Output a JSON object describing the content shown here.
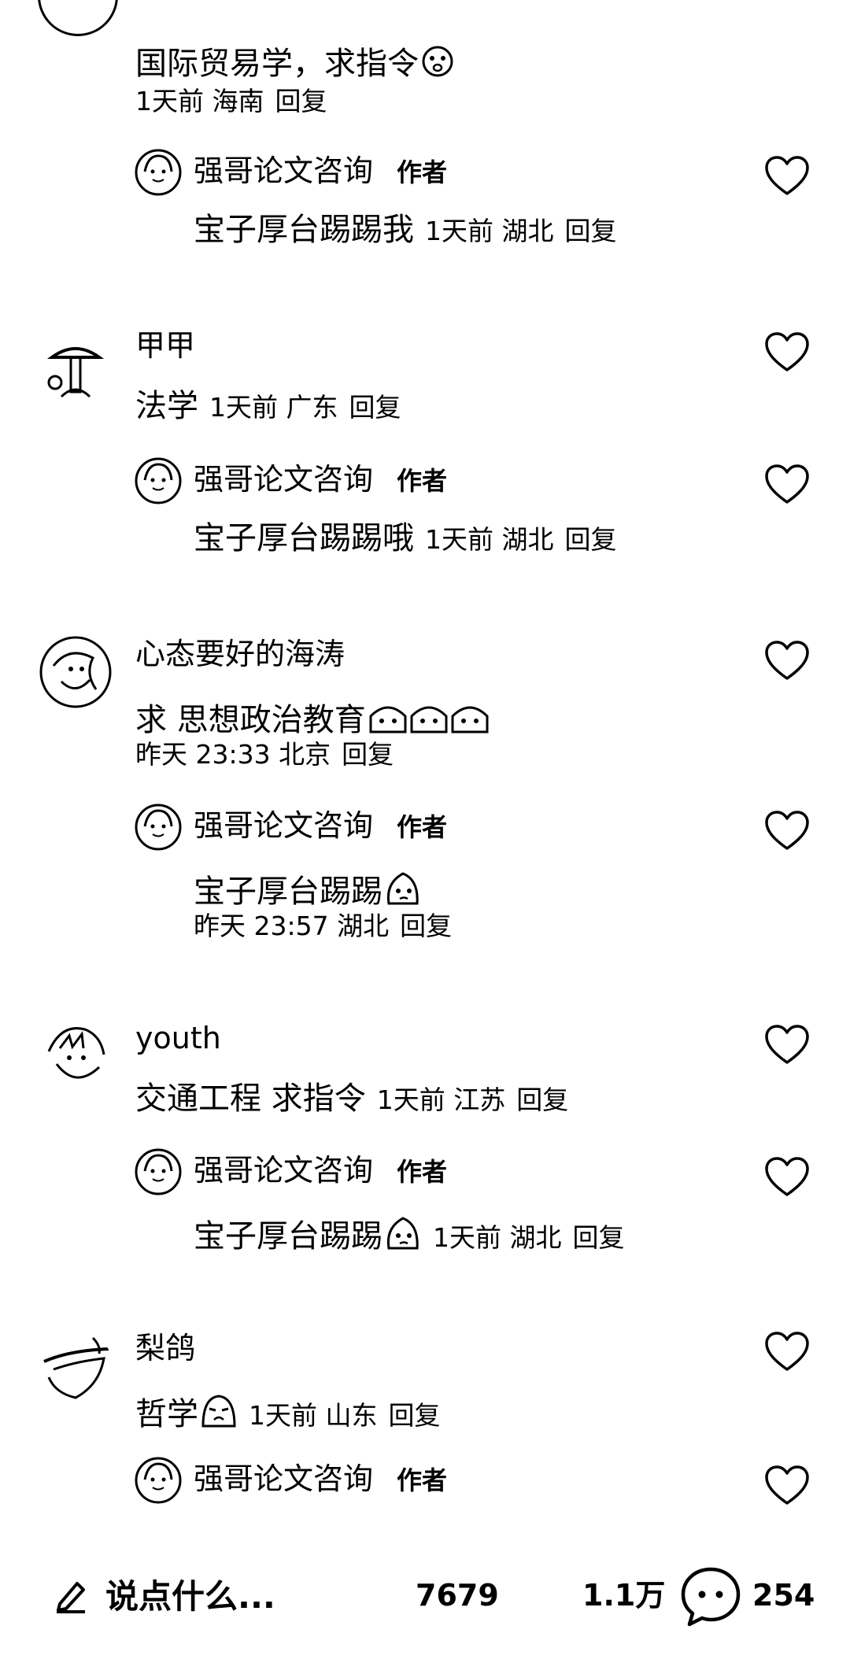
{
  "comments": [
    {
      "body": "国际贸易学，求指令",
      "meta": "1天前  海南",
      "reply_label": "回复",
      "reply": {
        "author": "强哥论文咨询",
        "badge": "作者",
        "body": "宝子厚台踢踢我",
        "meta": "1天前  湖北",
        "reply_label": "回复"
      }
    },
    {
      "username": "甲甲",
      "body": "法学",
      "meta": "1天前  广东",
      "reply_label": "回复",
      "reply": {
        "author": "强哥论文咨询",
        "badge": "作者",
        "body": "宝子厚台踢踢哦",
        "meta": "1天前  湖北",
        "reply_label": "回复"
      }
    },
    {
      "username": "心态要好的海涛",
      "body": "求 思想政治教育",
      "meta": "昨天 23:33 北京",
      "reply_label": "回复",
      "reply": {
        "author": "强哥论文咨询",
        "badge": "作者",
        "body": "宝子厚台踢踢",
        "meta": "昨天 23:57 湖北",
        "reply_label": "回复"
      }
    },
    {
      "username": "youth",
      "body": "交通工程 求指令",
      "meta": "1天前  江苏",
      "reply_label": "回复",
      "reply": {
        "author": "强哥论文咨询",
        "badge": "作者",
        "body": "宝子厚台踢踢",
        "meta": "1天前  湖北",
        "reply_label": "回复"
      }
    },
    {
      "username": "梨鸽",
      "body": "哲学",
      "meta": "1天前  山东",
      "reply_label": "回复",
      "reply": {
        "author": "强哥论文咨询",
        "badge": "作者"
      }
    }
  ],
  "bottom_bar": {
    "input_placeholder": "说点什么...",
    "likes_count": "7679",
    "favorites_count": "1.1万",
    "comments_count": "254"
  },
  "icons": {
    "edit": "pencil-icon",
    "like": "heart-outline-icon",
    "comment": "chat-bubble-icon"
  },
  "colors": {
    "text": "#000000",
    "background": "#ffffff"
  }
}
